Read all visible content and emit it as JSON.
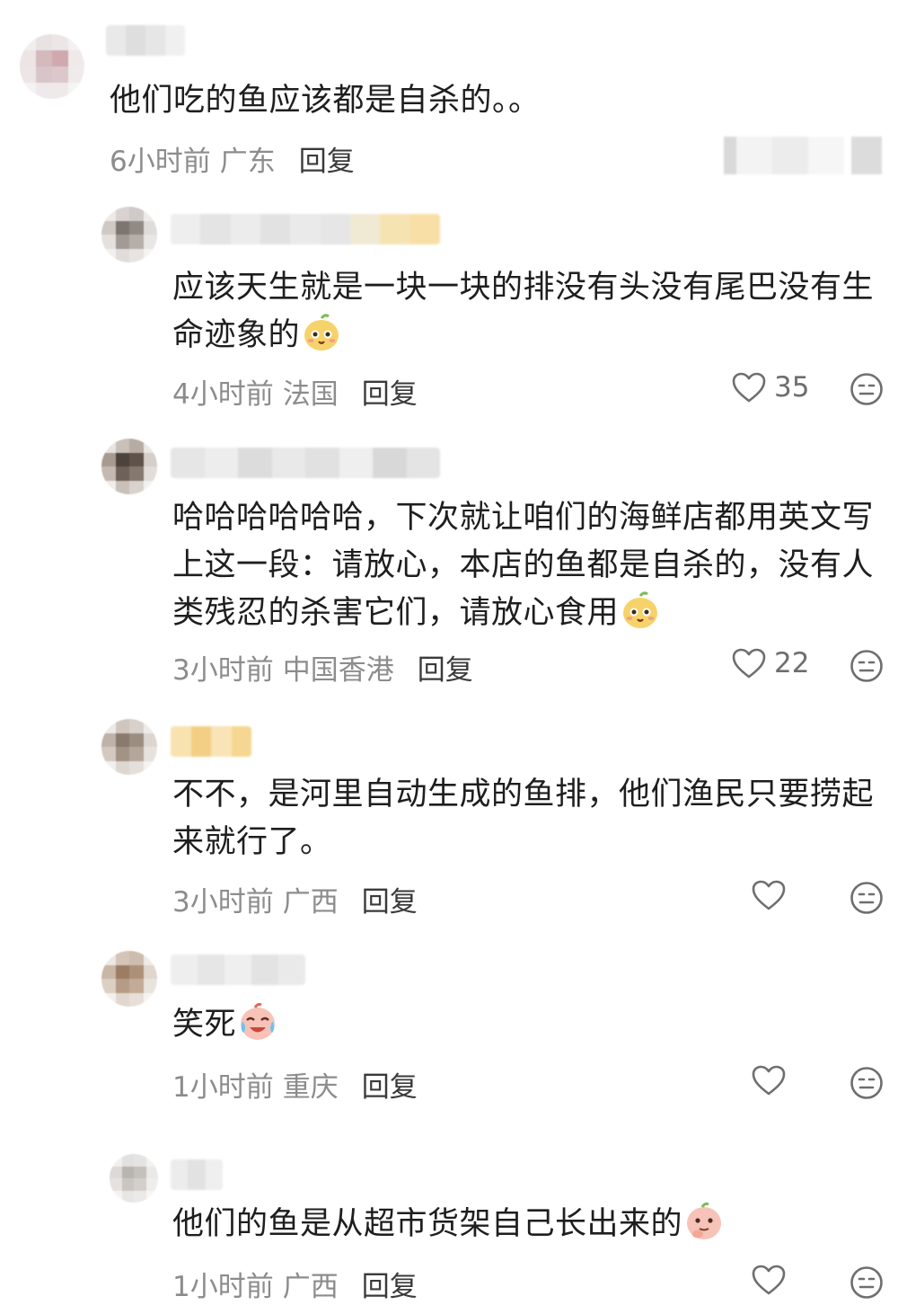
{
  "comments": [
    {
      "text": "他们吃的鱼应该都是自杀的。。",
      "time": "6小时前",
      "location": "广东",
      "reply_label": "回复",
      "emoji": ""
    },
    {
      "text": "应该天生就是一块一块的排没有头没有尾巴没有生命迹象的",
      "time": "4小时前",
      "location": "法国",
      "reply_label": "回复",
      "likes": "35",
      "emoji": "smiling-face-emoji"
    },
    {
      "text": "哈哈哈哈哈哈，下次就让咱们的海鲜店都用英文写上这一段：请放心，本店的鱼都是自杀的，没有人类残忍的杀害它们，请放心食用",
      "time": "3小时前",
      "location": "中国香港",
      "reply_label": "回复",
      "likes": "22",
      "emoji": "smiling-face-emoji"
    },
    {
      "text": "不不，是河里自动生成的鱼排，他们渔民只要捞起来就行了。",
      "time": "3小时前",
      "location": "广西",
      "reply_label": "回复",
      "likes": "",
      "emoji": ""
    },
    {
      "text": "笑死",
      "time": "1小时前",
      "location": "重庆",
      "reply_label": "回复",
      "likes": "",
      "emoji": "crying-laughing-emoji"
    },
    {
      "text": "他们的鱼是从超市货架自己长出来的",
      "time": "1小时前",
      "location": "广西",
      "reply_label": "回复",
      "likes": "",
      "emoji": "thinking-face-emoji"
    }
  ],
  "icons": {
    "like": "heart-outline-icon",
    "dislike": "neutral-face-icon"
  },
  "colors": {
    "meta_gray": "#8c8c8c",
    "reply_dark": "#3a3a3a",
    "text": "#1e1e1e"
  }
}
